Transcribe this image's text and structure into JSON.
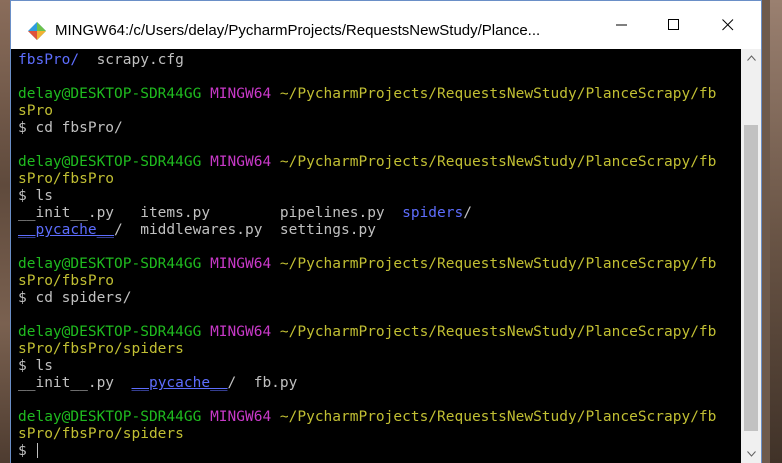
{
  "window": {
    "title": "MINGW64:/c/Users/delay/PycharmProjects/RequestsNewStudy/Plance...",
    "app_icon": "mingw-diamond-icon",
    "controls": {
      "minimize": "minimize-icon",
      "maximize": "maximize-icon",
      "close": "close-icon"
    }
  },
  "terminal": {
    "lines": [
      [
        {
          "t": "fbsPro/",
          "c": "blue"
        },
        {
          "t": "  scrapy.cfg",
          "c": "white"
        }
      ],
      [],
      [
        {
          "t": "delay@DESKTOP-SDR44GG",
          "c": "green"
        },
        {
          "t": " ",
          "c": "white"
        },
        {
          "t": "MINGW64",
          "c": "magenta"
        },
        {
          "t": " ~/PycharmProjects/RequestsNewStudy/PlanceScrapy/fb",
          "c": "yellow"
        }
      ],
      [
        {
          "t": "sPro",
          "c": "yellow"
        }
      ],
      [
        {
          "t": "$ cd fbsPro/",
          "c": "white"
        }
      ],
      [],
      [
        {
          "t": "delay@DESKTOP-SDR44GG",
          "c": "green"
        },
        {
          "t": " ",
          "c": "white"
        },
        {
          "t": "MINGW64",
          "c": "magenta"
        },
        {
          "t": " ~/PycharmProjects/RequestsNewStudy/PlanceScrapy/fb",
          "c": "yellow"
        }
      ],
      [
        {
          "t": "sPro/fbsPro",
          "c": "yellow"
        }
      ],
      [
        {
          "t": "$ ls",
          "c": "white"
        }
      ],
      [
        {
          "t": "__init__.py   items.py        pipelines.py  ",
          "c": "white"
        },
        {
          "t": "spiders",
          "c": "blue"
        },
        {
          "t": "/",
          "c": "white"
        }
      ],
      [
        {
          "t": "__pycache__",
          "c": "blue",
          "u": true
        },
        {
          "t": "/  middlewares.py  settings.py",
          "c": "white"
        }
      ],
      [],
      [
        {
          "t": "delay@DESKTOP-SDR44GG",
          "c": "green"
        },
        {
          "t": " ",
          "c": "white"
        },
        {
          "t": "MINGW64",
          "c": "magenta"
        },
        {
          "t": " ~/PycharmProjects/RequestsNewStudy/PlanceScrapy/fb",
          "c": "yellow"
        }
      ],
      [
        {
          "t": "sPro/fbsPro",
          "c": "yellow"
        }
      ],
      [
        {
          "t": "$ cd spiders/",
          "c": "white"
        }
      ],
      [],
      [
        {
          "t": "delay@DESKTOP-SDR44GG",
          "c": "green"
        },
        {
          "t": " ",
          "c": "white"
        },
        {
          "t": "MINGW64",
          "c": "magenta"
        },
        {
          "t": " ~/PycharmProjects/RequestsNewStudy/PlanceScrapy/fb",
          "c": "yellow"
        }
      ],
      [
        {
          "t": "sPro/fbsPro/spiders",
          "c": "yellow"
        }
      ],
      [
        {
          "t": "$ ls",
          "c": "white"
        }
      ],
      [
        {
          "t": "__init__.py  ",
          "c": "white"
        },
        {
          "t": "__pycache__",
          "c": "blue",
          "u": true
        },
        {
          "t": "/  fb.py",
          "c": "white"
        }
      ],
      [],
      [
        {
          "t": "delay@DESKTOP-SDR44GG",
          "c": "green"
        },
        {
          "t": " ",
          "c": "white"
        },
        {
          "t": "MINGW64",
          "c": "magenta"
        },
        {
          "t": " ~/PycharmProjects/RequestsNewStudy/PlanceScrapy/fb",
          "c": "yellow"
        }
      ],
      [
        {
          "t": "sPro/fbsPro/spiders",
          "c": "yellow"
        }
      ],
      [
        {
          "t": "$ ",
          "c": "white"
        }
      ]
    ],
    "cursor_line": 23
  },
  "colors": {
    "background": "#000000",
    "green": "#1fbb1f",
    "magenta": "#c839c8",
    "yellow": "#c1bf33",
    "blue": "#5d6dfd",
    "white": "#c0c0c0"
  }
}
